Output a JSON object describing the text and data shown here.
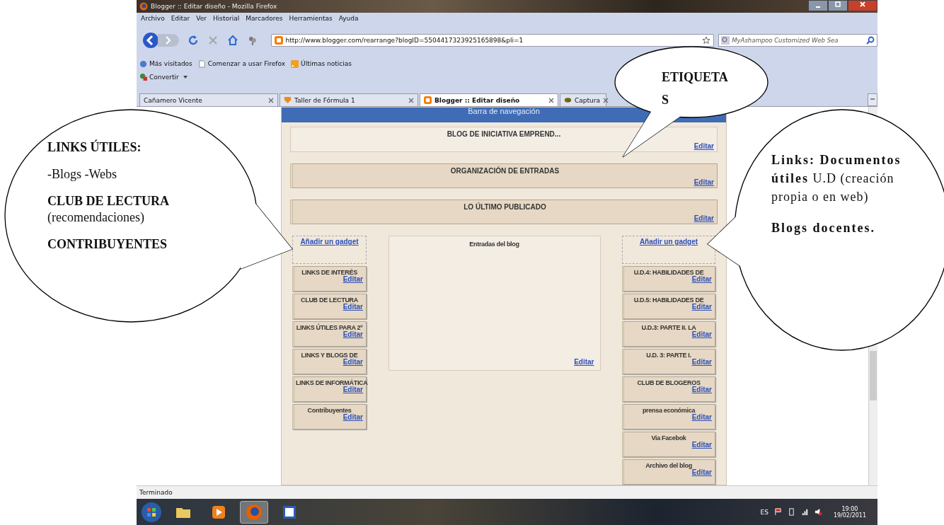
{
  "window": {
    "title": "Blogger :: Editar diseño - Mozilla Firefox"
  },
  "menu": [
    "Archivo",
    "Editar",
    "Ver",
    "Historial",
    "Marcadores",
    "Herramientas",
    "Ayuda"
  ],
  "address": {
    "value": "http://www.blogger.com/rearrange?blogID=5504417323925165898&pli=1"
  },
  "search": {
    "placeholder": "MyAshampoo Customized Web Sea"
  },
  "bookmarks": [
    {
      "label": "Más visitados",
      "kind": "globe"
    },
    {
      "label": "Comenzar a usar Firefox",
      "kind": "page"
    },
    {
      "label": "Últimas noticias",
      "kind": "feed"
    }
  ],
  "toolbar": {
    "label": "Convertir"
  },
  "tabs": [
    {
      "label": "Cañamero Vicente",
      "selected": false,
      "kind": "none"
    },
    {
      "label": "Taller de Fórmula 1",
      "selected": false,
      "kind": "shield"
    },
    {
      "label": "Blogger :: Editar diseño",
      "selected": true,
      "kind": "blogger"
    },
    {
      "label": "Captura",
      "selected": false,
      "kind": "leaf"
    }
  ],
  "layout": {
    "navbar": "Barra de navegación",
    "header": {
      "title": "BLOG DE INICIATIVA EMPREND...",
      "edit": "Editar"
    },
    "sections": [
      {
        "title": "ORGANIZACIÓN DE ENTRADAS",
        "edit": "Editar"
      },
      {
        "title": "LO ÚLTIMO PUBLICADO",
        "edit": "Editar"
      }
    ],
    "left": {
      "add": "Añadir un gadget",
      "gadgets": [
        {
          "title": "LINKS DE INTERÉS",
          "edit": "Editar"
        },
        {
          "title": "CLUB DE LECTURA",
          "edit": "Editar"
        },
        {
          "title": "LINKS ÚTILES PARA 2º",
          "edit": "Editar"
        },
        {
          "title": "LINKS Y BLOGS DE",
          "edit": "Editar"
        },
        {
          "title": "LINKS DE INFORMÁTICA",
          "edit": "Editar"
        },
        {
          "title": "Contribuyentes",
          "edit": "Editar"
        }
      ]
    },
    "main": {
      "title": "Entradas del blog",
      "edit": "Editar"
    },
    "right": {
      "add": "Añadir un gadget",
      "gadgets": [
        {
          "title": "U.D.4: HABILIDADES DE",
          "edit": "Editar"
        },
        {
          "title": "U.D.5: HABILIDADES DE",
          "edit": "Editar"
        },
        {
          "title": "U.D.3: PARTE II. LA",
          "edit": "Editar"
        },
        {
          "title": "U.D. 3: PARTE I.",
          "edit": "Editar"
        },
        {
          "title": "CLUB DE BLOGEROS",
          "edit": "Editar"
        },
        {
          "title": "prensa económica",
          "edit": "Editar"
        },
        {
          "title": "Via Facebok",
          "edit": "Editar"
        },
        {
          "title": "Archivo del blog",
          "edit": "Editar"
        }
      ]
    }
  },
  "status_bar": "Terminado",
  "taskbar": {
    "apps": [
      {
        "kind": "folder",
        "selected": false
      },
      {
        "kind": "media",
        "selected": false
      },
      {
        "kind": "firefox",
        "selected": true
      },
      {
        "kind": "word",
        "selected": false
      }
    ],
    "language": "ES",
    "time": "19:00",
    "date": "19/02/2011"
  },
  "callouts": [
    {
      "paragraphs": [
        {
          "text": "LINKS ÚTILES:",
          "bold": true
        },
        {
          "text": "-Blogs -Webs",
          "bold": false
        },
        {
          "text": "**CLUB DE LECTURA** (recomendaciones)",
          "bold": false
        },
        {
          "text": "CONTRIBUYENTES",
          "bold": true
        }
      ]
    },
    {
      "paragraphs": [
        {
          "text": "ETIQUETAS",
          "bold": true
        }
      ]
    },
    {
      "paragraphs": [
        {
          "text": "**Links: Documentos útiles** U.D (creación propia o en web)",
          "bold": false
        },
        {
          "text": "Blogs docentes.",
          "bold": true
        }
      ]
    }
  ]
}
